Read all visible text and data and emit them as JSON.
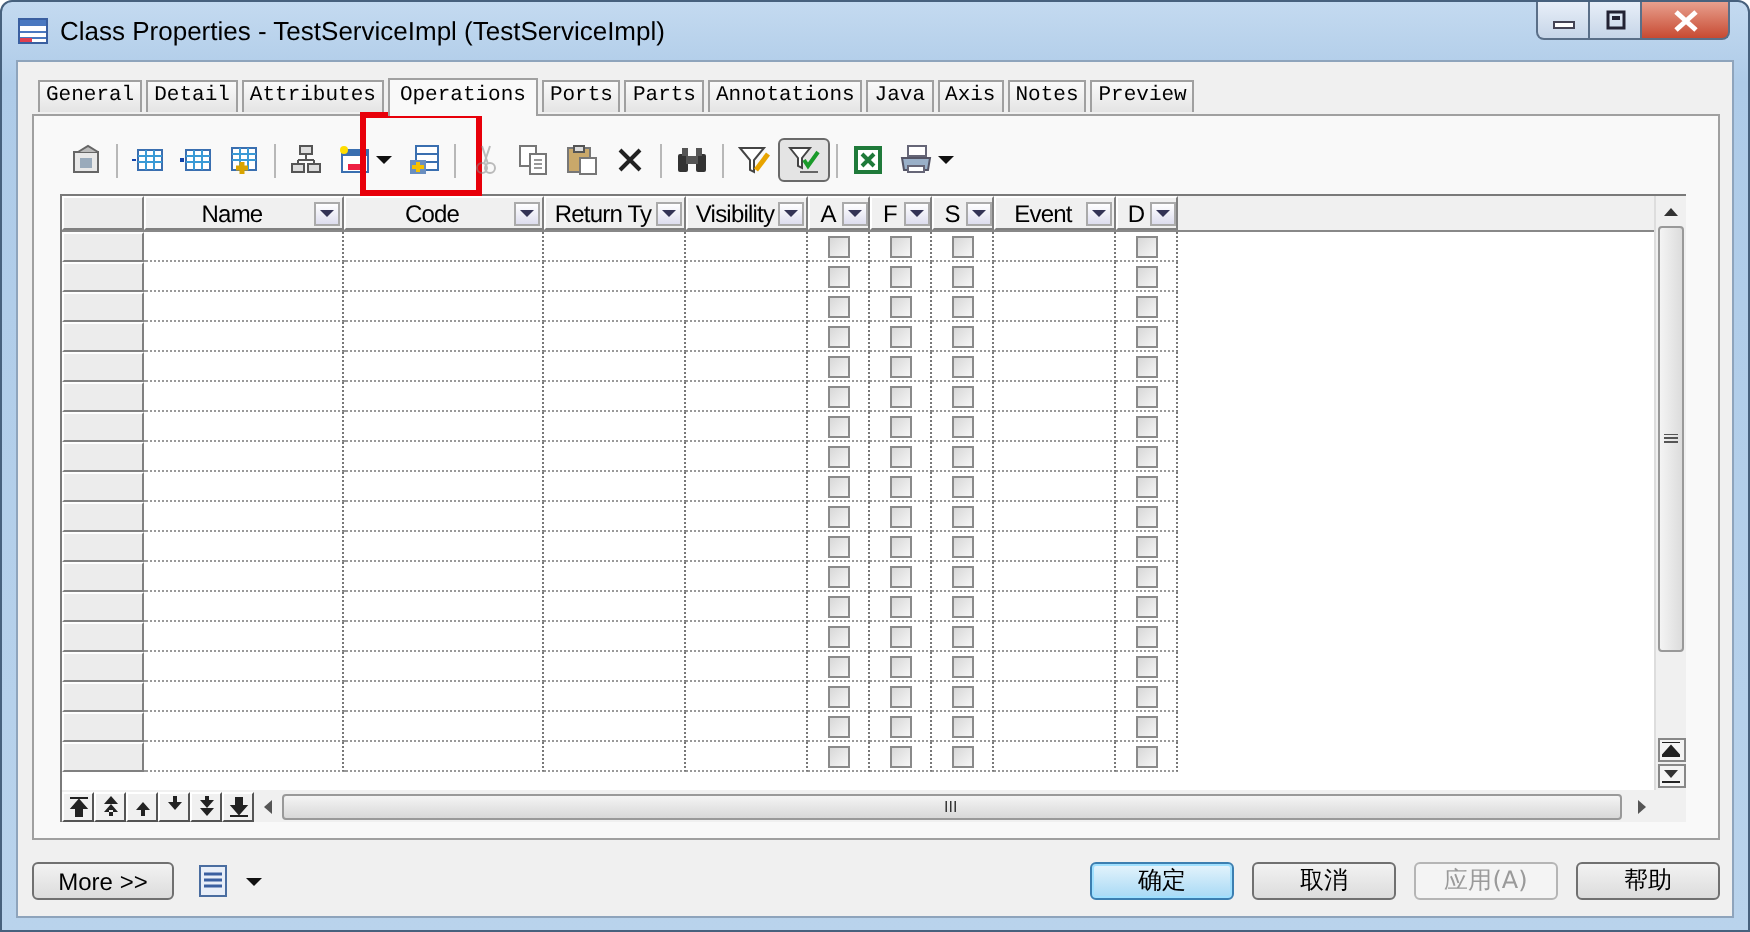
{
  "window": {
    "title": "Class Properties - TestServiceImpl (TestServiceImpl)"
  },
  "tabs": [
    {
      "label": "General",
      "selected": false
    },
    {
      "label": "Detail",
      "selected": false
    },
    {
      "label": "Attributes",
      "selected": false
    },
    {
      "label": "Operations",
      "selected": true
    },
    {
      "label": "Ports",
      "selected": false
    },
    {
      "label": "Parts",
      "selected": false
    },
    {
      "label": "Annotations",
      "selected": false
    },
    {
      "label": "Java",
      "selected": false
    },
    {
      "label": "Axis",
      "selected": false
    },
    {
      "label": "Notes",
      "selected": false
    },
    {
      "label": "Preview",
      "selected": false
    }
  ],
  "toolbar": [
    {
      "disabled": false,
      "pressed": false,
      "menu": false,
      "highlighted": false
    },
    {
      "disabled": false,
      "pressed": false,
      "menu": false,
      "highlighted": false
    },
    {
      "disabled": false,
      "pressed": false,
      "menu": false,
      "highlighted": false
    },
    {
      "disabled": false,
      "pressed": false,
      "menu": false,
      "highlighted": false
    },
    {
      "disabled": false,
      "pressed": false,
      "menu": false,
      "highlighted": false
    },
    {
      "disabled": false,
      "pressed": false,
      "menu": true,
      "highlighted": false
    },
    {
      "disabled": false,
      "pressed": false,
      "menu": false,
      "highlighted": true
    },
    {
      "disabled": true,
      "pressed": false,
      "menu": false,
      "highlighted": false
    },
    {
      "disabled": false,
      "pressed": false,
      "menu": false,
      "highlighted": false
    },
    {
      "disabled": false,
      "pressed": false,
      "menu": false,
      "highlighted": false
    },
    {
      "disabled": false,
      "pressed": false,
      "menu": false,
      "highlighted": false
    },
    {
      "disabled": false,
      "pressed": false,
      "menu": false,
      "highlighted": false
    },
    {
      "disabled": false,
      "pressed": false,
      "menu": false,
      "highlighted": false
    },
    {
      "disabled": false,
      "pressed": true,
      "menu": false,
      "highlighted": false
    },
    {
      "disabled": false,
      "pressed": false,
      "menu": false,
      "highlighted": false
    },
    {
      "disabled": false,
      "pressed": false,
      "menu": true,
      "highlighted": false
    }
  ],
  "grid": {
    "columns": [
      {
        "label": "Name",
        "kind": "text"
      },
      {
        "label": "Code",
        "kind": "text"
      },
      {
        "label": "Return Ty",
        "kind": "text"
      },
      {
        "label": "Visibility",
        "kind": "text"
      },
      {
        "label": "A",
        "kind": "check"
      },
      {
        "label": "F",
        "kind": "check"
      },
      {
        "label": "S",
        "kind": "check"
      },
      {
        "label": "Event",
        "kind": "text"
      },
      {
        "label": "D",
        "kind": "check"
      }
    ],
    "rows": [
      {
        "checks": [
          false,
          false,
          false,
          false
        ]
      },
      {
        "checks": [
          false,
          false,
          false,
          false
        ]
      },
      {
        "checks": [
          false,
          false,
          false,
          false
        ]
      },
      {
        "checks": [
          false,
          false,
          false,
          false
        ]
      },
      {
        "checks": [
          false,
          false,
          false,
          false
        ]
      },
      {
        "checks": [
          false,
          false,
          false,
          false
        ]
      },
      {
        "checks": [
          false,
          false,
          false,
          false
        ]
      },
      {
        "checks": [
          false,
          false,
          false,
          false
        ]
      },
      {
        "checks": [
          false,
          false,
          false,
          false
        ]
      },
      {
        "checks": [
          false,
          false,
          false,
          false
        ]
      },
      {
        "checks": [
          false,
          false,
          false,
          false
        ]
      },
      {
        "checks": [
          false,
          false,
          false,
          false
        ]
      },
      {
        "checks": [
          false,
          false,
          false,
          false
        ]
      },
      {
        "checks": [
          false,
          false,
          false,
          false
        ]
      },
      {
        "checks": [
          false,
          false,
          false,
          false
        ]
      },
      {
        "checks": [
          false,
          false,
          false,
          false
        ]
      },
      {
        "checks": [
          false,
          false,
          false,
          false
        ]
      },
      {
        "checks": [
          false,
          false,
          false,
          false
        ]
      }
    ],
    "scroll_thumb_label": "III"
  },
  "more_button": {
    "label": "More >>"
  },
  "buttons": [
    {
      "label": "确定",
      "default": true,
      "disabled": false
    },
    {
      "label": "取消",
      "default": false,
      "disabled": false
    },
    {
      "label": "应用(A)",
      "default": false,
      "disabled": true
    },
    {
      "label": "帮助",
      "default": false,
      "disabled": false
    }
  ]
}
